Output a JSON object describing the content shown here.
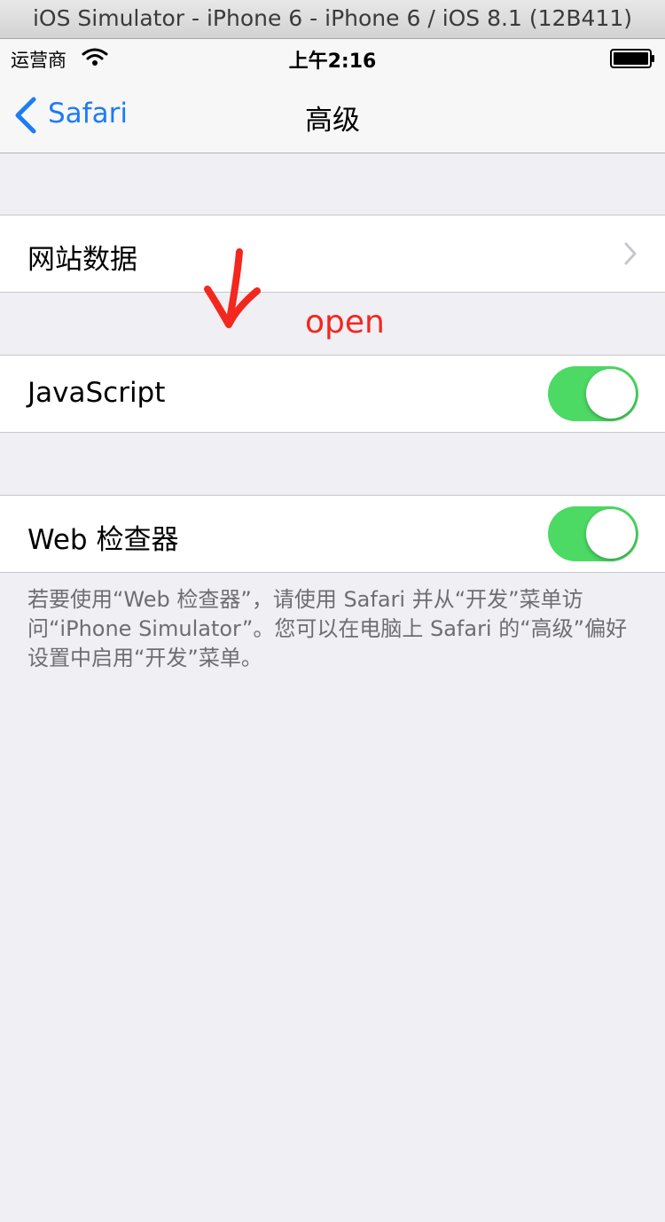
{
  "simulator": {
    "title": "iOS Simulator - iPhone 6 - iPhone 6 / iOS 8.1 (12B411)"
  },
  "statusbar": {
    "carrier": "运营商",
    "time": "上午2:16",
    "icons": [
      "wifi-icon",
      "battery-icon"
    ]
  },
  "navbar": {
    "back_label": "Safari",
    "back_icon": "chevron-left-icon",
    "title": "高级",
    "tint_color": "#1d7cf6"
  },
  "settings": {
    "website_data": {
      "label": "网站数据",
      "accessory": "chevron-right-icon"
    },
    "javascript": {
      "label": "JavaScript",
      "on": true
    },
    "web_inspector": {
      "label": "Web 检查器",
      "on": true
    },
    "toggle_on_color": "#4cd964"
  },
  "footer": {
    "note": "若要使用“Web 检查器”，请使用 Safari 并从“开发”菜单访问“iPhone Simulator”。您可以在电脑上 Safari 的“高级”偏好设置中启用“开发”菜单。"
  },
  "annotation": {
    "text": "open",
    "color": "#f2281e"
  }
}
